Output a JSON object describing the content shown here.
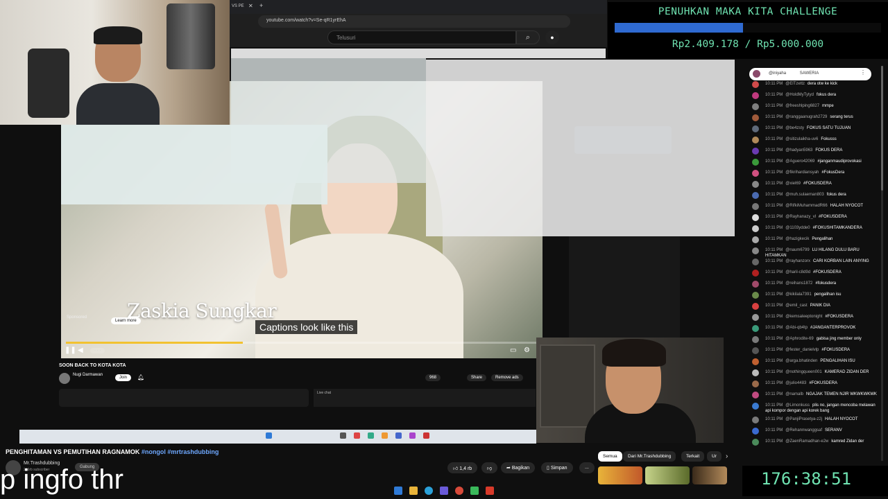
{
  "browser": {
    "tab_label": "VS PE",
    "url": "youtube.com/watch?v=Se-qR1yrEhA",
    "search_placeholder": "Telusuri"
  },
  "video": {
    "name_overlay": "Zaskia Sungkar",
    "caption": "Captions look like this",
    "progress_fraction": 0.375,
    "ad_sponsor_label": "Sponsored",
    "ad_learn_more": "Learn more"
  },
  "inner_yt": {
    "title": "SOON BACK TO KOTA KOTA",
    "channel": "Nugi Darmawan",
    "join": "Join",
    "actions": [
      "968",
      "Share",
      "Remove ads"
    ],
    "live_chat_label": "Live chat"
  },
  "goal": {
    "title": "PENUHKAN MAKA KITA CHALLENGE",
    "amount": "Rp2.409.178 / Rp5.000.000",
    "progress_fraction": 0.4818
  },
  "chat": {
    "header_user": "@iniyaha",
    "header_label": "SAWERIA",
    "messages": [
      {
        "time": "10:11 PM",
        "author": "@ElTzettz",
        "text": "dera otw ke kick",
        "color": "#d04a4a"
      },
      {
        "time": "10:11 PM",
        "author": "@HoldMyTytyd",
        "text": "fokus dera",
        "color": "#c0397e"
      },
      {
        "time": "10:11 PM",
        "author": "@freeshlping6827",
        "text": "mmpe",
        "color": "#7f7f7f"
      },
      {
        "time": "10:11 PM",
        "author": "@ranggaanugrah2729",
        "text": "serang terus",
        "color": "#a05a3a"
      },
      {
        "time": "10:11 PM",
        "author": "@be4zsty",
        "text": "FOKUS SATU TUJUAN",
        "color": "#5f6a7a"
      },
      {
        "time": "10:11 PM",
        "author": "@sitizulaikha-uv6",
        "text": "Fokusss",
        "color": "#b08a5a"
      },
      {
        "time": "10:11 PM",
        "author": "@hadyan5963",
        "text": "FOKUS DERA",
        "color": "#6a3ab0"
      },
      {
        "time": "10:11 PM",
        "author": "@Aguero42069",
        "text": "#janganmaudiprovokasi",
        "color": "#3a9a3a"
      },
      {
        "time": "10:11 PM",
        "author": "@fikrihardiansyah",
        "text": "#FokusDera",
        "color": "#d05080"
      },
      {
        "time": "10:11 PM",
        "author": "@xiel69",
        "text": "#FOKUSDERA",
        "color": "#888"
      },
      {
        "time": "10:11 PM",
        "author": "@muh.sulaeman803",
        "text": "fokus dera",
        "color": "#4a6ab0"
      },
      {
        "time": "10:11 PM",
        "author": "@RifkiMuhammadR66",
        "text": "HALAH NYOCOT",
        "color": "#777"
      },
      {
        "time": "10:11 PM",
        "author": "@Rayhanazy_vl",
        "text": "#FOKUSDERA",
        "color": "#ddd"
      },
      {
        "time": "10:11 PM",
        "author": "@1103ydde0",
        "text": "#FOKUSHITAMKANDERA",
        "color": "#ccc"
      },
      {
        "time": "10:11 PM",
        "author": "@hazigkecik",
        "text": "Pengalihan",
        "color": "#aaa"
      },
      {
        "time": "10:11 PM",
        "author": "@naum6799",
        "text": "LU HILANG DULU BARU HITAMKAN",
        "color": "#888"
      },
      {
        "time": "10:11 PM",
        "author": "@rayhanzorx",
        "text": "CARI KORBAN LAIN ANYING",
        "color": "#666"
      },
      {
        "time": "10:11 PM",
        "author": "@haril-c8d9d",
        "text": "#FOKUSDERA",
        "color": "#b02020"
      },
      {
        "time": "10:11 PM",
        "author": "@reihans1872",
        "text": "#fokusdera",
        "color": "#a04a6a"
      },
      {
        "time": "10:11 PM",
        "author": "@kikilala7391",
        "text": "pengalihan isu",
        "color": "#6a8a4a"
      },
      {
        "time": "10:11 PM",
        "author": "@emil_cast",
        "text": "PANIK DIA",
        "color": "#d84040"
      },
      {
        "time": "10:11 PM",
        "author": "@kemsaleeptonight",
        "text": "#FOKUSDERA",
        "color": "#999"
      },
      {
        "time": "10:11 PM",
        "author": "@Abi-qb4tp",
        "text": "#JANGANTERPROVOK",
        "color": "#3a9a7a"
      },
      {
        "time": "10:11 PM",
        "author": "@Aphrodite-69",
        "text": "gabisa jing member only",
        "color": "#7a7a7a"
      },
      {
        "time": "10:11 PM",
        "author": "@fester_danielvlp",
        "text": "#FOKUSDERA",
        "color": "#555"
      },
      {
        "time": "10:11 PM",
        "author": "@arga.bhatinden",
        "text": "PENGALIHAN ISU",
        "color": "#c06030"
      },
      {
        "time": "10:11 PM",
        "author": "@nothingqueen001",
        "text": "KAMERAD ZIDAN DER",
        "color": "#bbb"
      },
      {
        "time": "10:11 PM",
        "author": "@julio4483",
        "text": "#FOKUSDERA",
        "color": "#9a6a4a"
      },
      {
        "time": "10:11 PM",
        "author": "@namalb",
        "text": "NGAJAK TEMEN NJIR WKWKWKWK",
        "color": "#c04a80"
      },
      {
        "time": "10:11 PM",
        "author": "@Limonkuss",
        "text": "plis no, jangan mencoba melawan api kompor dengan api korek bang",
        "color": "#3a7ad0"
      },
      {
        "time": "10:11 PM",
        "author": "@PanjiPrasetya-z2j",
        "text": "HALAH NYOCOT",
        "color": "#7a7a7a"
      },
      {
        "time": "10:11 PM",
        "author": "@Rehannwanggsaf",
        "text": "SERANV",
        "color": "#3a6ad0"
      },
      {
        "time": "10:11 PM",
        "author": "@ZaenRamadhan-e2w",
        "text": "kamred Zidan der",
        "color": "#4a8a5a"
      }
    ]
  },
  "bottom": {
    "title": "PENGHITAMAN VS PEMUTIHAN RAGNAMOK ",
    "tag1": "#nongol",
    "tag2": "#mrtrashdubbing",
    "channel": "Mr.Trashdubbing",
    "subs": "266rb subscriber",
    "join_label": "Gabung",
    "ticker": "p ingfo thr",
    "likes": "1,4 rb",
    "share": "Bagikan",
    "save": "Simpan",
    "more": "...",
    "chips": [
      "Semua",
      "Dari Mr.Trashdubbing",
      "Terkait",
      "Ur"
    ]
  },
  "timer": "176:38:51"
}
